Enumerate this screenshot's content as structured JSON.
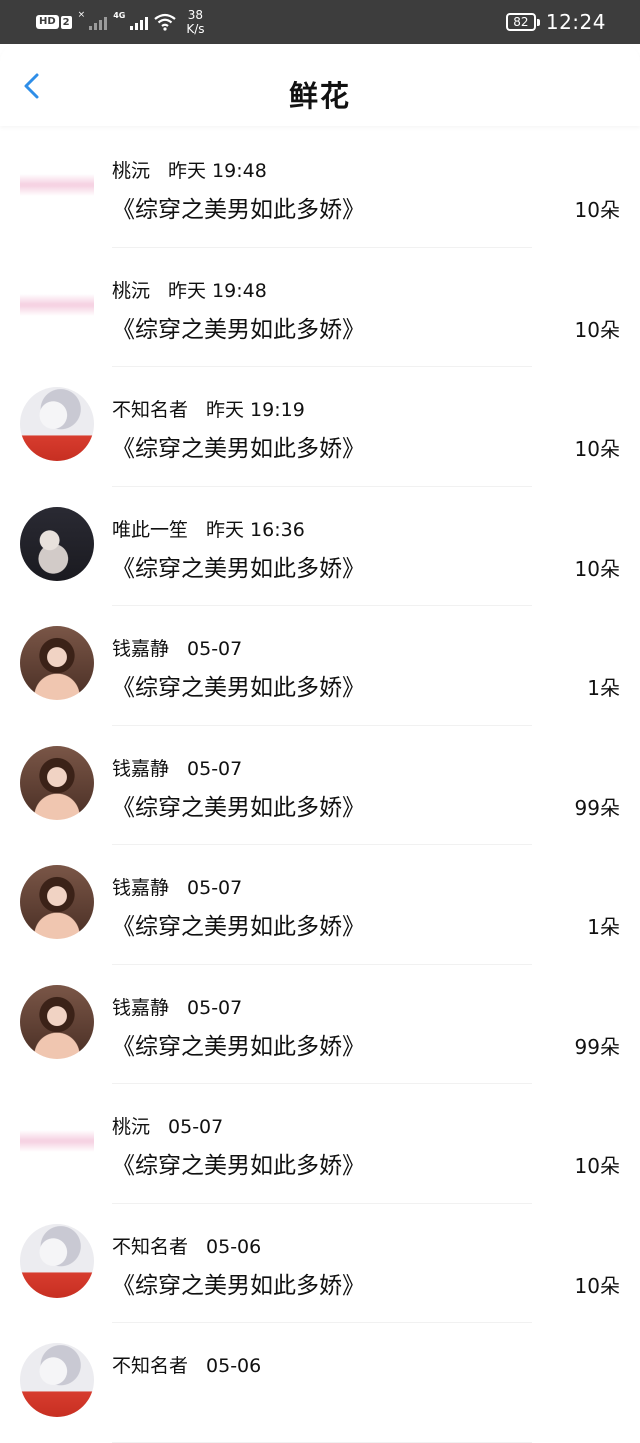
{
  "status_bar": {
    "hd": "HD",
    "sim": "2",
    "net": "4G",
    "speed_value": "38",
    "speed_unit": "K/s",
    "battery": "82",
    "time": "12:24",
    "icon": "wifi-icon"
  },
  "header": {
    "title": "鲜花",
    "back_icon": "chevron-left-icon",
    "accent": "#2f8ee8"
  },
  "items": [
    {
      "name": "桃沅",
      "time": "昨天 19:48",
      "book": "《综穿之美男如此多娇》",
      "count": "10朵",
      "avatar": "logo"
    },
    {
      "name": "桃沅",
      "time": "昨天 19:48",
      "book": "《综穿之美男如此多娇》",
      "count": "10朵",
      "avatar": "logo"
    },
    {
      "name": "不知名者",
      "time": "昨天 19:19",
      "book": "《综穿之美男如此多娇》",
      "count": "10朵",
      "avatar": "anime"
    },
    {
      "name": "唯此一笙",
      "time": "昨天 16:36",
      "book": "《综穿之美男如此多娇》",
      "count": "10朵",
      "avatar": "dark"
    },
    {
      "name": "钱嘉静",
      "time": "05-07",
      "book": "《综穿之美男如此多娇》",
      "count": "1朵",
      "avatar": "girl"
    },
    {
      "name": "钱嘉静",
      "time": "05-07",
      "book": "《综穿之美男如此多娇》",
      "count": "99朵",
      "avatar": "girl"
    },
    {
      "name": "钱嘉静",
      "time": "05-07",
      "book": "《综穿之美男如此多娇》",
      "count": "1朵",
      "avatar": "girl"
    },
    {
      "name": "钱嘉静",
      "time": "05-07",
      "book": "《综穿之美男如此多娇》",
      "count": "99朵",
      "avatar": "girl"
    },
    {
      "name": "桃沅",
      "time": "05-07",
      "book": "《综穿之美男如此多娇》",
      "count": "10朵",
      "avatar": "logo"
    },
    {
      "name": "不知名者",
      "time": "05-06",
      "book": "《综穿之美男如此多娇》",
      "count": "10朵",
      "avatar": "anime"
    },
    {
      "name": "不知名者",
      "time": "05-06",
      "book": "",
      "count": "",
      "avatar": "anime"
    }
  ]
}
